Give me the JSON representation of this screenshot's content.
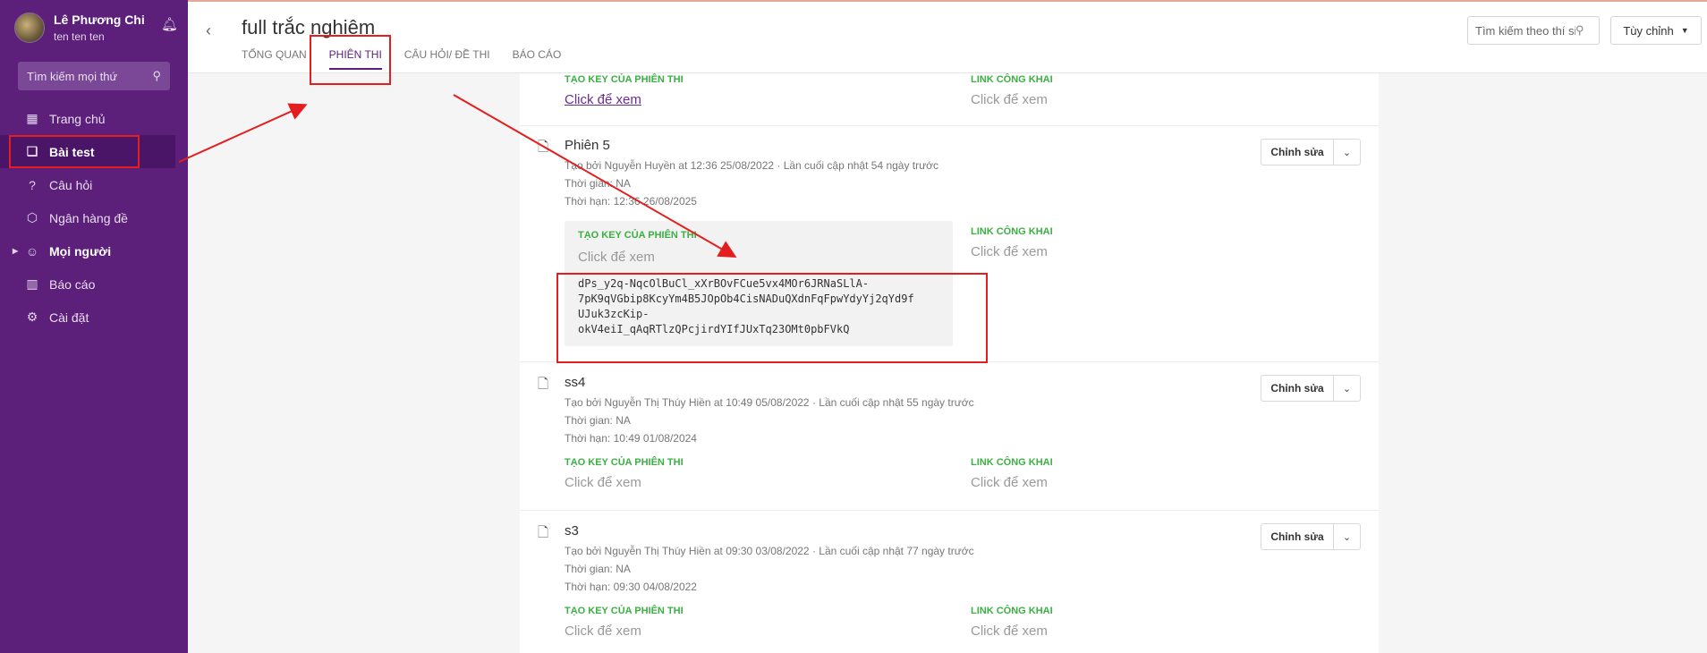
{
  "sidebar": {
    "user_name": "Lê Phương Chi",
    "user_sub": "ten ten ten",
    "search_placeholder": "Tìm kiếm mọi thứ",
    "items": [
      {
        "label": "Trang chủ",
        "icon": "grid-icon",
        "glyph": "▦"
      },
      {
        "label": "Bài test",
        "icon": "book-icon",
        "glyph": "❑",
        "active": true
      },
      {
        "label": "Câu hỏi",
        "icon": "question-icon",
        "glyph": "?"
      },
      {
        "label": "Ngân hàng đề",
        "icon": "cube-icon",
        "glyph": "⬡"
      },
      {
        "label": "Mọi người",
        "icon": "user-circle-icon",
        "glyph": "☺"
      },
      {
        "label": "Báo cáo",
        "icon": "bar-chart-icon",
        "glyph": "▥"
      },
      {
        "label": "Cài đặt",
        "icon": "gear-icon",
        "glyph": "⚙"
      }
    ]
  },
  "header": {
    "title": "full trắc nghiệm",
    "tabs": [
      "TỔNG QUAN",
      "PHIÊN THI",
      "CÂU HỎI/ ĐỀ THI",
      "BÁO CÁO"
    ],
    "active_tab": "PHIÊN THI",
    "search_placeholder": "Tìm kiếm theo thí sinh",
    "custom_label": "Tùy chỉnh"
  },
  "labels": {
    "key_label": "TẠO KEY CỦA PHIÊN THI",
    "public_label": "LINK CÔNG KHAI",
    "click_view": "Click để xem",
    "edit": "Chỉnh sửa"
  },
  "sessions": [
    {
      "name": "Phiên 5",
      "created": "Tạo bởi Nguyễn Huyền at 12:36 25/08/2022 · Lần cuối cập nhật 54 ngày trước",
      "time": "Thời gian: NA",
      "deadline": "Thời hạn: 12:36 26/08/2025",
      "key": "dPs_y2q-NqcOlBuCl_xXrBOvFCue5vx4MOr6JRNaSLlA-\n7pK9qVGbip8KcyYm4B5JOpOb4CisNADuQXdnFqFpwYdyYj2qYd9f\nUJuk3zcKip-\nokV4eiI_qAqRTlzQPcjirdYIfJUxTq23OMt0pbFVkQ"
    },
    {
      "name": "ss4",
      "created": "Tạo bởi Nguyễn Thị Thúy Hiền at 10:49 05/08/2022 · Lần cuối cập nhật 55 ngày trước",
      "time": "Thời gian: NA",
      "deadline": "Thời hạn: 10:49 01/08/2024"
    },
    {
      "name": "s3",
      "created": "Tạo bởi Nguyễn Thị Thúy Hiền at 09:30 03/08/2022 · Lần cuối cập nhật 77 ngày trước",
      "time": "Thời gian: NA",
      "deadline": "Thời hạn: 09:30 04/08/2022"
    }
  ],
  "colors": {
    "sidebar_bg": "#5c1f7a",
    "accent": "#5c1f7a",
    "label_green": "#3cb043",
    "annotation_red": "#e41e1e"
  }
}
